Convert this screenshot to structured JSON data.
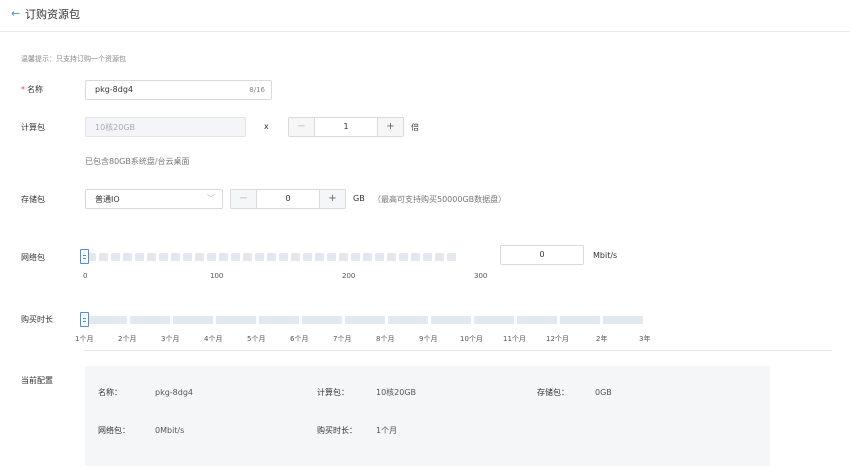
{
  "header": {
    "title": "订购资源包"
  },
  "tip": "温馨提示：只支持订购一个资源包",
  "name_field": {
    "label": "名称",
    "required_mark": "*",
    "value": "pkg-8dg4",
    "count": "8/16"
  },
  "compute": {
    "label": "计算包",
    "value": "10核20GB",
    "times": "x",
    "quantity": "1",
    "unit": "倍",
    "note": "已包含80GB系统盘/台云桌面"
  },
  "storage": {
    "label": "存储包",
    "type": "普通IO",
    "quantity": "0",
    "unit": "GB",
    "note": "（最高可支持购买50000GB数据盘）"
  },
  "network": {
    "label": "网络包",
    "value": "0",
    "unit": "Mbit/s",
    "level": 0,
    "ticks": [
      "0",
      "100",
      "200",
      "300"
    ]
  },
  "duration": {
    "label": "购买时长",
    "selected_index": 0,
    "options": [
      "1个月",
      "2个月",
      "3个月",
      "4个月",
      "5个月",
      "6个月",
      "7个月",
      "8个月",
      "9个月",
      "10个月",
      "11个月",
      "12个月",
      "2年",
      "3年"
    ]
  },
  "summary": {
    "label": "当前配置",
    "name_key": "名称：",
    "name_val": "pkg-8dg4",
    "compute_key": "计算包：",
    "compute_val": "10核20GB",
    "storage_key": "存储包：",
    "storage_val": "0GB",
    "network_key": "网络包：",
    "network_val": "0Mbit/s",
    "duration_key": "购买时长：",
    "duration_val": "1个月"
  },
  "colors": {
    "accent": "#4a8fe7",
    "required": "#e5484d",
    "track": "#e3e8ef"
  },
  "icons": {
    "back": "arrow-left-icon",
    "select": "chevron-down-icon"
  }
}
